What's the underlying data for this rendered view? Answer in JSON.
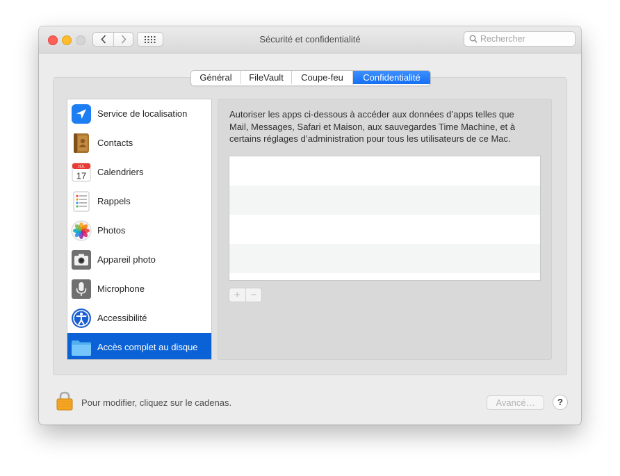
{
  "window": {
    "title": "Sécurité et confidentialité"
  },
  "search": {
    "placeholder": "Rechercher"
  },
  "tabs": [
    {
      "label": "Général",
      "active": false
    },
    {
      "label": "FileVault",
      "active": false
    },
    {
      "label": "Coupe-feu",
      "active": false
    },
    {
      "label": "Confidentialité",
      "active": true
    }
  ],
  "sidebar": {
    "items": [
      {
        "label": "Service de localisation",
        "icon": "location-arrow-icon"
      },
      {
        "label": "Contacts",
        "icon": "contacts-book-icon"
      },
      {
        "label": "Calendriers",
        "icon": "calendar-icon"
      },
      {
        "label": "Rappels",
        "icon": "reminders-icon"
      },
      {
        "label": "Photos",
        "icon": "photos-icon"
      },
      {
        "label": "Appareil photo",
        "icon": "camera-icon"
      },
      {
        "label": "Microphone",
        "icon": "microphone-icon"
      },
      {
        "label": "Accessibilité",
        "icon": "accessibility-icon"
      },
      {
        "label": "Accès complet au disque",
        "icon": "folder-icon",
        "selected": true
      }
    ]
  },
  "calendar_icon": {
    "month": "JUL",
    "day": "17"
  },
  "main": {
    "description": "Autoriser les apps ci-dessous à accéder aux données d’apps telles que Mail, Messages, Safari et Maison, aux sauvegardes Time Machine, et à certains réglages d’administration pour tous les utilisateurs de ce Mac.",
    "add_label": "+",
    "remove_label": "−"
  },
  "footer": {
    "lock_text": "Pour modifier, cliquez sur le cadenas.",
    "advanced_label": "Avancé…",
    "help_label": "?"
  },
  "colors": {
    "accent": "#0a62d6",
    "tab_active": "#1b74f5"
  }
}
